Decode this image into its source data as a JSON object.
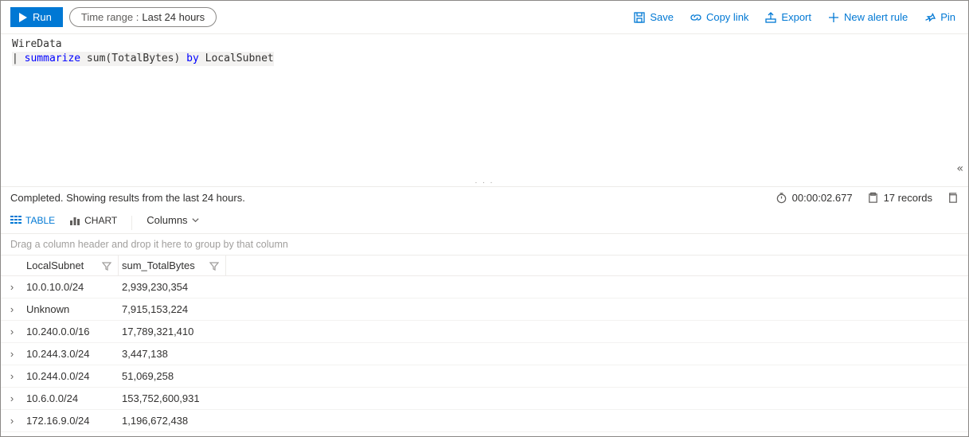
{
  "toolbar": {
    "run": "Run",
    "timerange_label": "Time range :",
    "timerange_value": "Last 24 hours",
    "save": "Save",
    "copylink": "Copy link",
    "export": "Export",
    "newalert": "New alert rule",
    "pin": "Pin"
  },
  "query": {
    "line1": "WireData",
    "pipe": "|",
    "kw1": "summarize",
    "fn": " sum(TotalBytes) ",
    "kw2": "by",
    "tail": " LocalSubnet"
  },
  "status": {
    "text": "Completed. Showing results from the last 24 hours.",
    "elapsed": "00:00:02.677",
    "records": "17 records"
  },
  "views": {
    "table": "TABLE",
    "chart": "CHART",
    "columns": "Columns"
  },
  "groupby_hint": "Drag a column header and drop it here to group by that column",
  "columns": {
    "c1": "LocalSubnet",
    "c2": "sum_TotalBytes"
  },
  "rows": [
    {
      "c1": "10.0.10.0/24",
      "c2": "2,939,230,354"
    },
    {
      "c1": "Unknown",
      "c2": "7,915,153,224"
    },
    {
      "c1": "10.240.0.0/16",
      "c2": "17,789,321,410"
    },
    {
      "c1": "10.244.3.0/24",
      "c2": "3,447,138"
    },
    {
      "c1": "10.244.0.0/24",
      "c2": "51,069,258"
    },
    {
      "c1": "10.6.0.0/24",
      "c2": "153,752,600,931"
    },
    {
      "c1": "172.16.9.0/24",
      "c2": "1,196,672,438"
    }
  ]
}
